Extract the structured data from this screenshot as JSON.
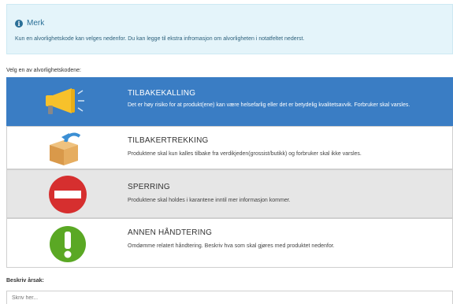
{
  "alert": {
    "title": "Merk",
    "text": "Kun en alvorlighetskode kan velges nedenfor. Du kan legge til ekstra infromasjon om alvorligheten i notatfeltet nederst."
  },
  "prompt": "Velg en av alvorlighetskodene:",
  "options": [
    {
      "title": "TILBAKEKALLING",
      "desc": "Det er høy risiko for at produkt(ene) kan være helsefarlig eller det er betydelig kvalitetsavvik. Forbruker skal varsles.",
      "icon": "megaphone-icon",
      "selected": true
    },
    {
      "title": "TILBAKERTREKKING",
      "desc": "Produktene skal kun kalles tilbake fra verdikjeden(grossist/butikk) og forbruker skal ikke varsles.",
      "icon": "box-return-icon",
      "selected": false
    },
    {
      "title": "SPERRING",
      "desc": "Produktene skal holdes i karantene inntil mer informasjon kommer.",
      "icon": "no-entry-icon",
      "selected": false
    },
    {
      "title": "ANNEN HÅNDTERING",
      "desc": "Omdømme relatert håndtering. Beskriv hva som skal gjøres med produktet nedenfor.",
      "icon": "exclamation-icon",
      "selected": false
    }
  ],
  "reason": {
    "label": "Beskriv årsak:",
    "placeholder": "Skriv her..."
  },
  "colors": {
    "selected": "#3a7dc4",
    "alert_bg": "#e4f4fa",
    "megaphone": "#f7c12b",
    "box": "#e0a95a",
    "arrow": "#3b8fd4",
    "stop": "#d62f2f",
    "ok": "#5aa824"
  }
}
